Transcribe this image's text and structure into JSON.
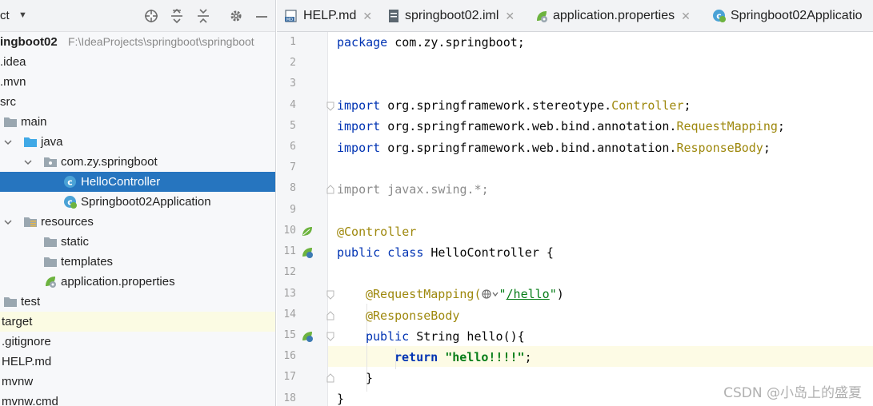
{
  "project_panel": {
    "title": "ct",
    "root": {
      "name": "ingboot02",
      "path": "F:\\IdeaProjects\\springboot\\springboot"
    },
    "items": [
      {
        "label": ".idea"
      },
      {
        "label": ".mvn"
      },
      {
        "label": "src"
      },
      {
        "label": "main"
      },
      {
        "label": "java"
      },
      {
        "label": "com.zy.springboot"
      },
      {
        "label": "HelloController"
      },
      {
        "label": "Springboot02Application"
      },
      {
        "label": "resources"
      },
      {
        "label": "static"
      },
      {
        "label": "templates"
      },
      {
        "label": "application.properties"
      },
      {
        "label": "test"
      },
      {
        "label": "target"
      },
      {
        "label": ".gitignore"
      },
      {
        "label": "HELP.md"
      },
      {
        "label": "mvnw"
      },
      {
        "label": "mvnw.cmd"
      }
    ]
  },
  "tabs": [
    {
      "label": "HELP.md",
      "icon": "markdown-icon"
    },
    {
      "label": "springboot02.iml",
      "icon": "module-file-icon"
    },
    {
      "label": "application.properties",
      "icon": "spring-properties-icon"
    },
    {
      "label": "Springboot02Applicatio",
      "icon": "spring-class-icon"
    }
  ],
  "editor": {
    "line_numbers": [
      "1",
      "2",
      "3",
      "4",
      "5",
      "6",
      "7",
      "8",
      "9",
      "10",
      "11",
      "12",
      "13",
      "14",
      "15",
      "16",
      "17",
      "18"
    ],
    "lines": {
      "l1": {
        "kw": "package",
        "rest": " com.zy.springboot;"
      },
      "l4": {
        "kw": "import",
        "pkg": " org.springframework.stereotype.",
        "cls": "Controller",
        "end": ";"
      },
      "l5": {
        "kw": "import",
        "pkg": " org.springframework.web.bind.annotation.",
        "cls": "RequestMapping",
        "end": ";"
      },
      "l6": {
        "kw": "import",
        "pkg": " org.springframework.web.bind.annotation.",
        "cls": "ResponseBody",
        "end": ";"
      },
      "l8": {
        "kw": "import",
        "rest": " javax.swing.*;"
      },
      "l10": {
        "ann": "@Controller"
      },
      "l11": {
        "kw1": "public",
        "kw2": "class",
        "rest": " HelloController {"
      },
      "l13": {
        "ann": "@RequestMapping(",
        "str_open": "\"",
        "link": "/hello",
        "str_close": "\"",
        "end": ")"
      },
      "l14": {
        "ann": "@ResponseBody"
      },
      "l15": {
        "kw": "public",
        "rest": " String hello(){"
      },
      "l16": {
        "kw": "return",
        "str": "\"hello!!!!\"",
        "end": ";"
      },
      "l17": {
        "rest": "}"
      },
      "l18": {
        "rest": "}"
      }
    }
  },
  "watermark": "CSDN @小岛上的盛夏",
  "colors": {
    "selection": "#2675bf",
    "keyword": "#0033b3",
    "annotation": "#9e880d",
    "string": "#067d17",
    "current_line": "#fdfbe5"
  }
}
